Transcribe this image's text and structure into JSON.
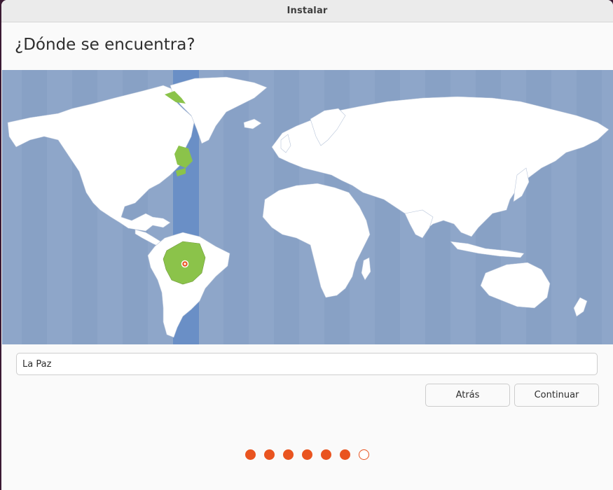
{
  "window": {
    "title": "Instalar"
  },
  "page": {
    "heading": "¿Dónde se encuentra?"
  },
  "map": {
    "selected_timezone_region": "Bolivia",
    "marker": "La Paz",
    "colors": {
      "ocean": "#8ea6c9",
      "land": "#ffffff",
      "highlight_band": "#6a8fc6",
      "selected_land": "#8bc34a",
      "marker": "#e95420"
    }
  },
  "location": {
    "value": "La Paz"
  },
  "buttons": {
    "back_label": "Atrás",
    "continue_label": "Continuar"
  },
  "progress": {
    "total_steps": 7,
    "completed_steps": 6
  },
  "theme": {
    "accent": "#e95420"
  }
}
